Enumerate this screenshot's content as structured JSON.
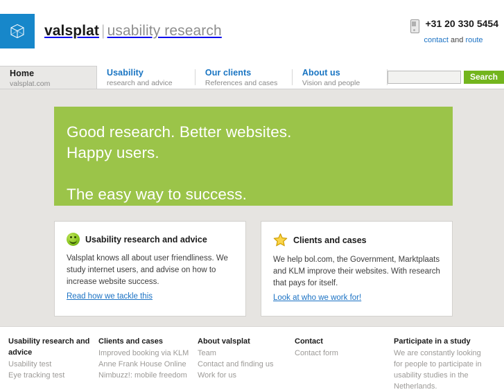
{
  "header": {
    "logo": {
      "icon": "cube-icon",
      "brand": "valsplat",
      "separator": "|",
      "tagline": "usability research"
    },
    "contact": {
      "phone_icon": "phone-icon",
      "phone": "+31 20 330 5454",
      "link_contact": "contact",
      "link_and": " and ",
      "link_route": "route"
    }
  },
  "nav": {
    "items": [
      {
        "title": "Home",
        "sub": "valsplat.com",
        "active": true
      },
      {
        "title": "Usability",
        "sub": "research and advice",
        "active": false
      },
      {
        "title": "Our clients",
        "sub": "References and cases",
        "active": false
      },
      {
        "title": "About us",
        "sub": "Vision and people",
        "active": false
      }
    ],
    "search": {
      "value": "",
      "placeholder": "",
      "button_label": "Search"
    }
  },
  "hero": {
    "line1": "Good research. Better websites.",
    "line2": "Happy users.",
    "line3": "The easy way to success.",
    "background_color": "#9bc449"
  },
  "cards": [
    {
      "icon": "smiley-icon",
      "title": "Usability research and advice",
      "body": "Valsplat knows all about user friendliness. We study internet users, and advise on how to increase website success.",
      "link": "Read how we tackle this"
    },
    {
      "icon": "star-icon",
      "title": "Clients and cases",
      "body": "We help bol.com, the Government, Marktplaats and KLM improve their websites. With research that pays for itself.",
      "link": "Look at who we work for!"
    }
  ],
  "footer": {
    "columns": [
      {
        "heading": "Usability research and advice",
        "links": [
          "Usability test",
          "Eye tracking test"
        ]
      },
      {
        "heading": "Clients and cases",
        "links": [
          "Improved booking via KLM",
          "Anne Frank House Online",
          "Nimbuzz!: mobile freedom"
        ]
      },
      {
        "heading": "About valsplat",
        "links": [
          "Team",
          "Contact and finding us",
          "Work for us"
        ]
      },
      {
        "heading": "Contact",
        "links": [
          "Contact form"
        ]
      },
      {
        "heading": "Participate in a study",
        "text": "We are constantly looking for people to participate in usability studies in the Netherlands."
      }
    ]
  },
  "colors": {
    "brand_blue": "#1787ca",
    "link_blue": "#1b72c4",
    "hero_green": "#9bc449",
    "button_green": "#73b51e",
    "content_bg": "#e6e4e1"
  }
}
